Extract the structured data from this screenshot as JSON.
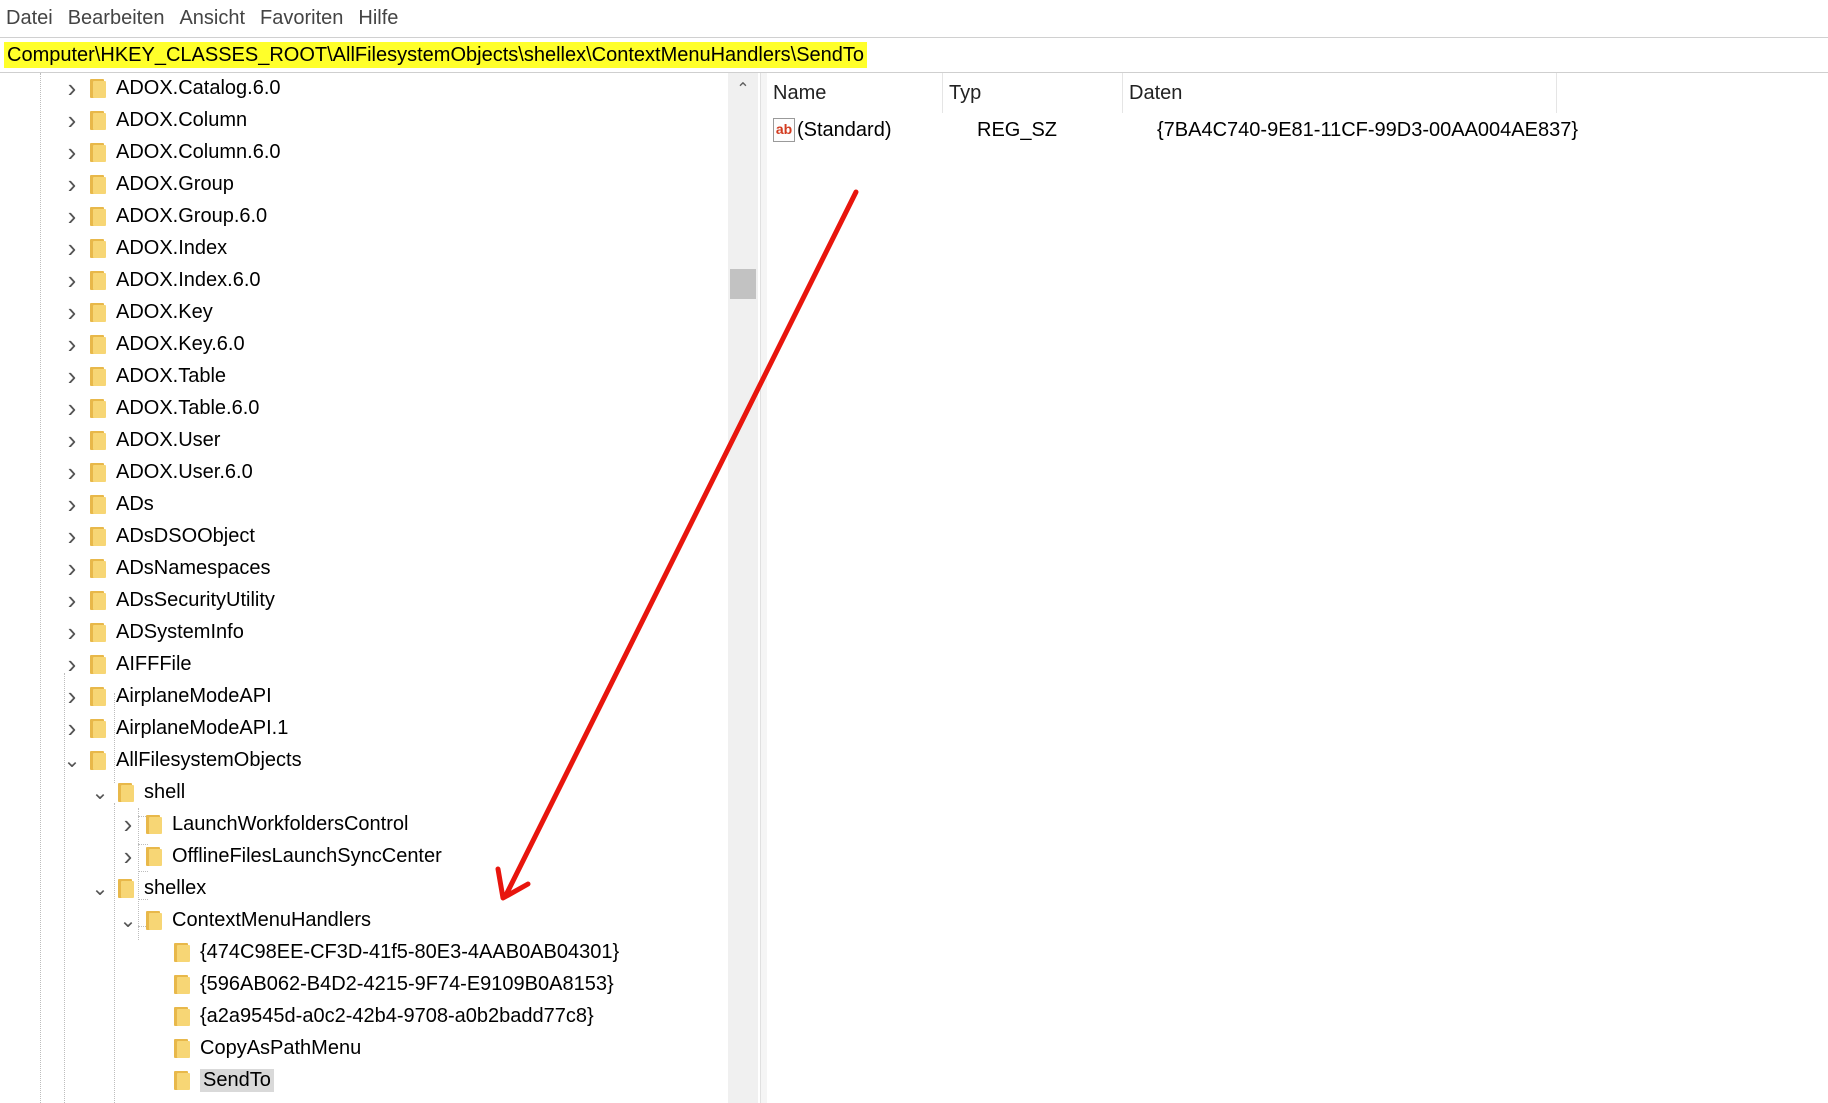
{
  "menu": [
    "Datei",
    "Bearbeiten",
    "Ansicht",
    "Favoriten",
    "Hilfe"
  ],
  "address": "Computer\\HKEY_CLASSES_ROOT\\AllFilesystemObjects\\shellex\\ContextMenuHandlers\\SendTo",
  "tree": [
    {
      "label": "ADOX.Catalog.6.0",
      "state": "collapsed"
    },
    {
      "label": "ADOX.Column",
      "state": "collapsed"
    },
    {
      "label": "ADOX.Column.6.0",
      "state": "collapsed"
    },
    {
      "label": "ADOX.Group",
      "state": "collapsed"
    },
    {
      "label": "ADOX.Group.6.0",
      "state": "collapsed"
    },
    {
      "label": "ADOX.Index",
      "state": "collapsed"
    },
    {
      "label": "ADOX.Index.6.0",
      "state": "collapsed"
    },
    {
      "label": "ADOX.Key",
      "state": "collapsed"
    },
    {
      "label": "ADOX.Key.6.0",
      "state": "collapsed"
    },
    {
      "label": "ADOX.Table",
      "state": "collapsed"
    },
    {
      "label": "ADOX.Table.6.0",
      "state": "collapsed"
    },
    {
      "label": "ADOX.User",
      "state": "collapsed"
    },
    {
      "label": "ADOX.User.6.0",
      "state": "collapsed"
    },
    {
      "label": "ADs",
      "state": "collapsed"
    },
    {
      "label": "ADsDSOObject",
      "state": "collapsed"
    },
    {
      "label": "ADsNamespaces",
      "state": "collapsed"
    },
    {
      "label": "ADsSecurityUtility",
      "state": "collapsed"
    },
    {
      "label": "ADSystemInfo",
      "state": "collapsed"
    },
    {
      "label": "AIFFFile",
      "state": "collapsed"
    },
    {
      "label": "AirplaneModeAPI",
      "state": "collapsed"
    },
    {
      "label": "AirplaneModeAPI.1",
      "state": "collapsed"
    },
    {
      "label": "AllFilesystemObjects",
      "state": "expanded"
    },
    {
      "label": "shell",
      "state": "expanded"
    },
    {
      "label": "LaunchWorkfoldersControl",
      "state": "collapsed"
    },
    {
      "label": "OfflineFilesLaunchSyncCenter",
      "state": "collapsed"
    },
    {
      "label": "shellex",
      "state": "expanded"
    },
    {
      "label": "ContextMenuHandlers",
      "state": "expanded"
    },
    {
      "label": "{474C98EE-CF3D-41f5-80E3-4AAB0AB04301}",
      "state": "leaf"
    },
    {
      "label": "{596AB062-B4D2-4215-9F74-E9109B0A8153}",
      "state": "leaf"
    },
    {
      "label": "{a2a9545d-a0c2-42b4-9708-a0b2badd77c8}",
      "state": "leaf"
    },
    {
      "label": "CopyAsPathMenu",
      "state": "leaf"
    },
    {
      "label": "SendTo",
      "state": "leaf",
      "selected": true
    }
  ],
  "list": {
    "headers": {
      "name": "Name",
      "type": "Typ",
      "data": "Daten"
    },
    "rows": [
      {
        "name": "(Standard)",
        "type": "REG_SZ",
        "data": "{7BA4C740-9E81-11CF-99D3-00AA004AE837}",
        "icon": "string-value-icon"
      }
    ]
  },
  "annotation": {
    "color": "#e8150d"
  }
}
